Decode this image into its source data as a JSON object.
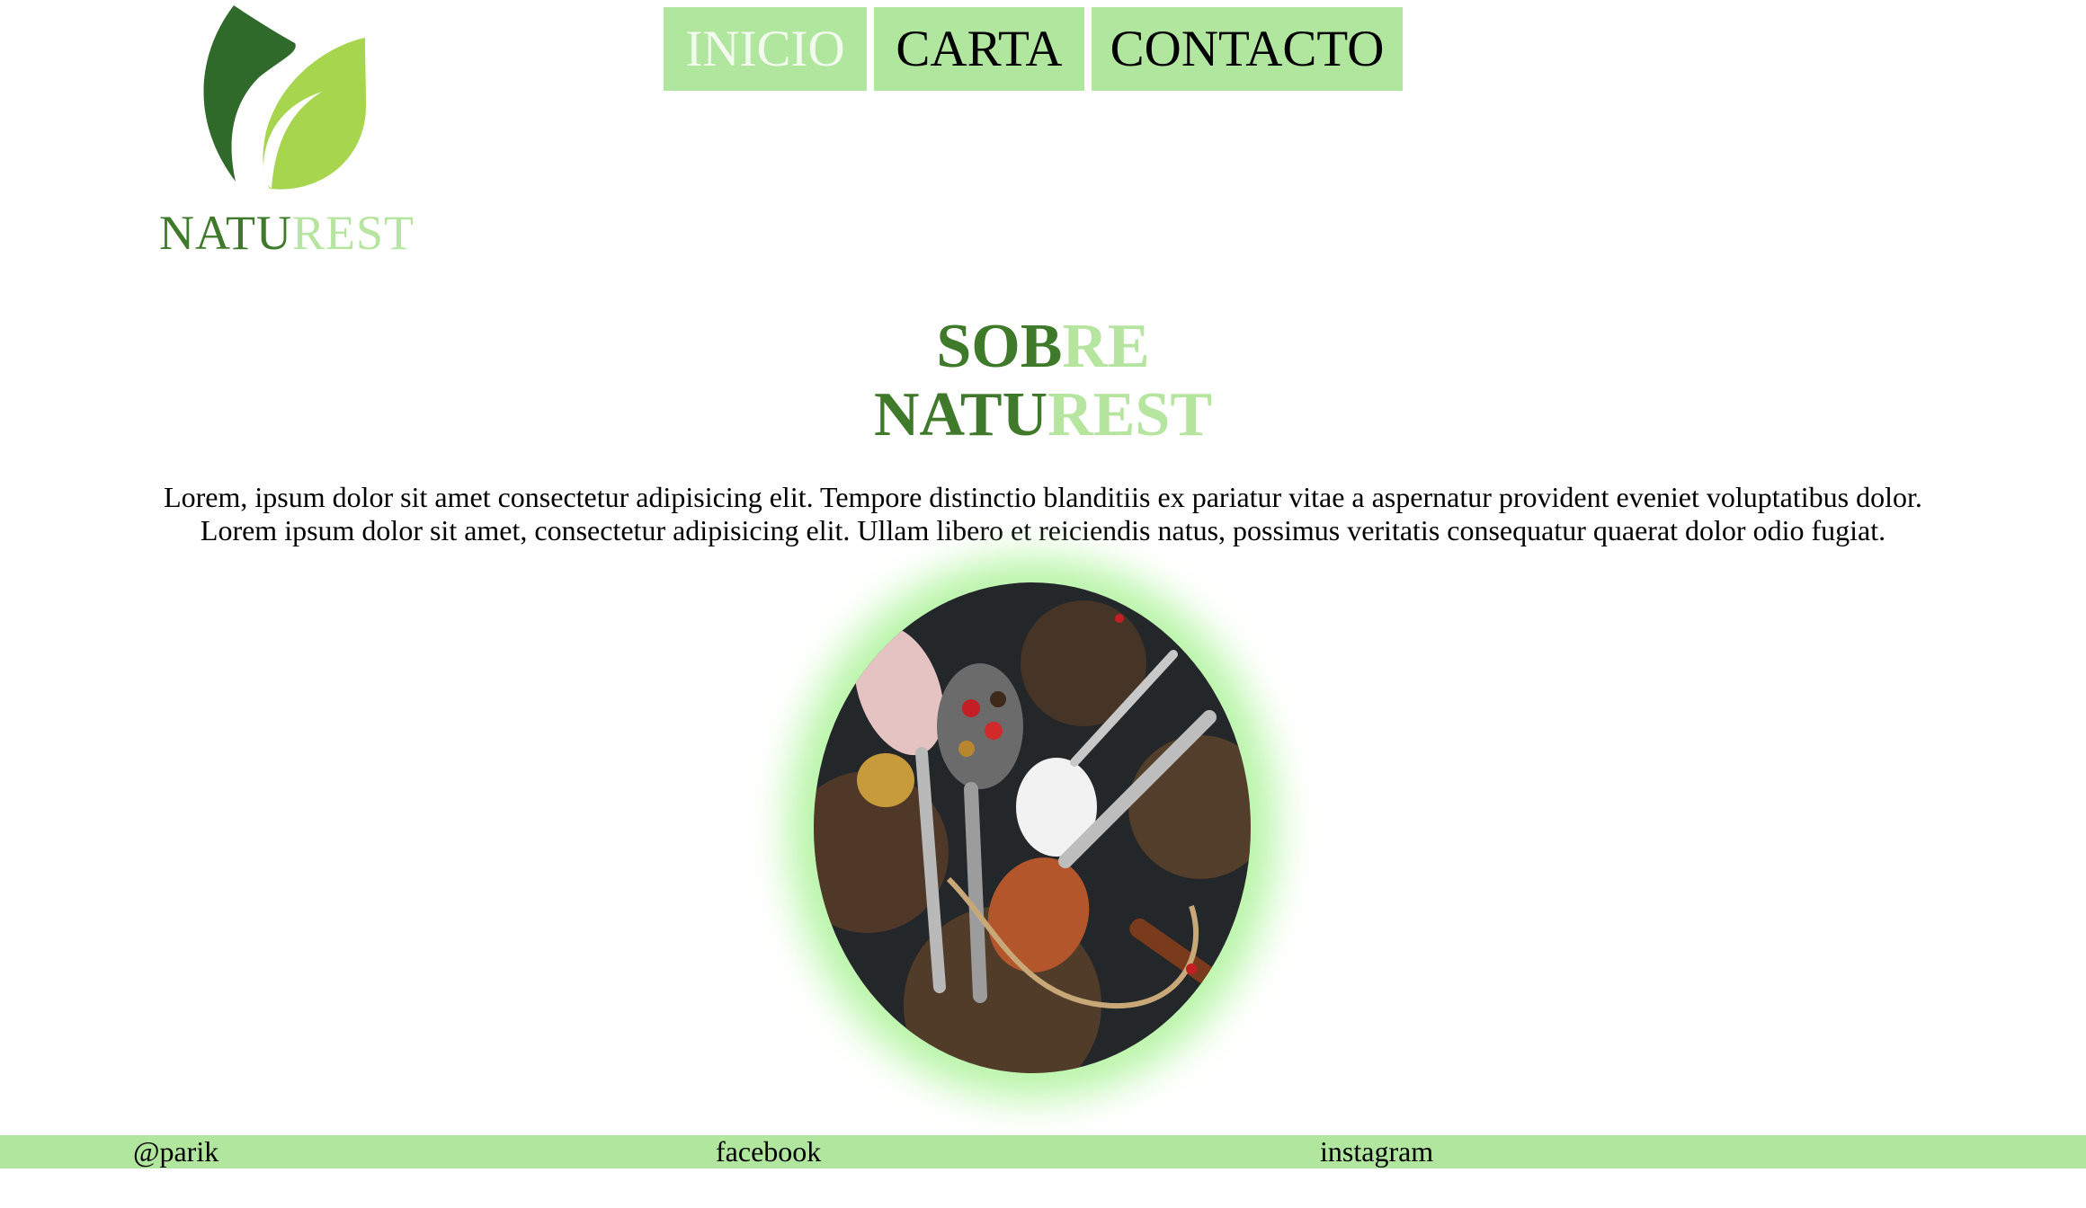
{
  "brand": {
    "name_part1": "NATU",
    "name_part2": "REST",
    "logo_icon": "leaf-icon",
    "colors": {
      "dark_green": "#3e7a2a",
      "light_green": "#b6e59f",
      "nav_bg": "#b1e69e"
    }
  },
  "nav": {
    "items": [
      {
        "label": "INICIO",
        "active": true
      },
      {
        "label": "CARTA",
        "active": false
      },
      {
        "label": "CONTACTO",
        "active": false
      }
    ]
  },
  "about": {
    "title_line1_part1": "SOB",
    "title_line1_part2": "RE",
    "title_line2_part1": "NATU",
    "title_line2_part2": "REST",
    "paragraph_line1": "Lorem, ipsum dolor sit amet consectetur adipisicing elit. Tempore distinctio blanditiis ex pariatur vitae a aspernatur provident eveniet voluptatibus dolor.",
    "paragraph_line2": "Lorem ipsum dolor sit amet, consectetur adipisicing elit. Ullam libero et reiciendis natus, possimus veritatis consequatur quaerat dolor odio fugiat.",
    "image": "spices-photo"
  },
  "footer": {
    "handle": "@parik",
    "facebook": "facebook",
    "instagram": "instagram"
  }
}
